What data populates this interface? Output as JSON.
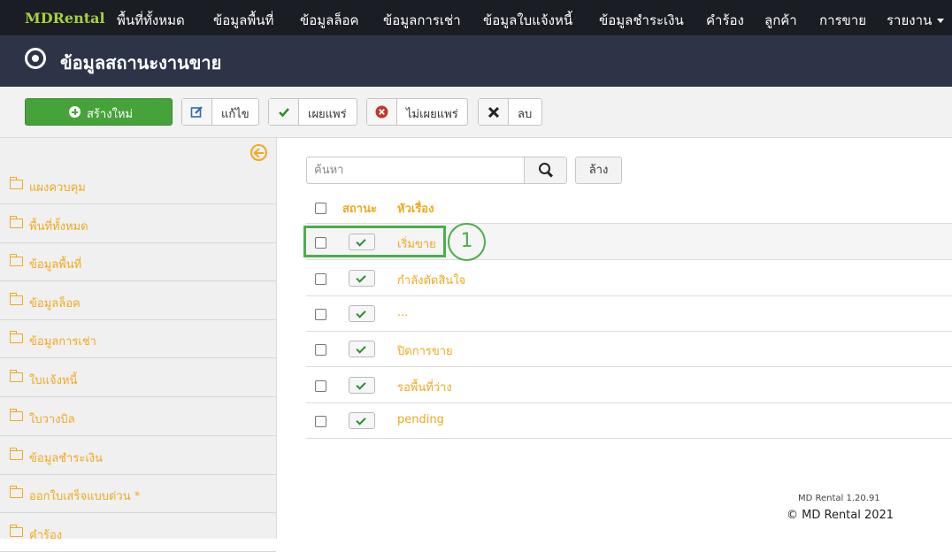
{
  "topnav": {
    "brand": "MDRental",
    "items": [
      "พื้นที่ทั้งหมด",
      "ข้อมูลพื้นที่",
      "ข้อมูลล็อค",
      "ข้อมูลการเช่า",
      "ข้อมูลใบแจ้งหนี้",
      "ข้อมูลชำระเงิน",
      "คำร้อง",
      "ลูกค้า",
      "การขาย",
      "รายงาน"
    ]
  },
  "page": {
    "title": "ข้อมูลสถานะงานขาย"
  },
  "toolbar": {
    "new_label": "สร้างใหม่",
    "edit_label": "แก้ไข",
    "publish_label": "เผยแพร่",
    "unpublish_label": "ไม่เผยแพร่",
    "delete_label": "ลบ"
  },
  "sidebar": {
    "items": [
      {
        "label": "แผงควบคุม"
      },
      {
        "label": "พื้นที่ทั้งหมด"
      },
      {
        "label": "ข้อมูลพื้นที่"
      },
      {
        "label": "ข้อมูลล็อค"
      },
      {
        "label": "ข้อมูลการเช่า"
      },
      {
        "label": "ใบแจ้งหนี้"
      },
      {
        "label": "ใบวางบิล"
      },
      {
        "label": "ข้อมูลชำระเงิน"
      },
      {
        "label": "ออกใบเสร็จแบบด่วน *"
      },
      {
        "label": "คำร้อง"
      }
    ]
  },
  "search": {
    "placeholder": "ค้นหา",
    "clear_label": "ล้าง"
  },
  "table": {
    "col_status": "สถานะ",
    "col_title": "หัวเรื่อง",
    "rows": [
      {
        "title": "เริ่มขาย",
        "published": true
      },
      {
        "title": "กำลังตัดสินใจ",
        "published": true
      },
      {
        "title": "...",
        "published": true
      },
      {
        "title": "ปิดการขาย",
        "published": true
      },
      {
        "title": "รอพื้นที่ว่าง",
        "published": true
      },
      {
        "title": "pending",
        "published": true
      }
    ]
  },
  "annotation": {
    "marker": "1"
  },
  "footer": {
    "version": "MD Rental 1.20.91",
    "copyright": "© MD Rental 2021"
  },
  "colors": {
    "accent": "#f2a81d",
    "nav_bg": "#1b1d24",
    "header_bg": "#2e3448",
    "success": "#45a33a",
    "highlight": "#4cae4c"
  }
}
